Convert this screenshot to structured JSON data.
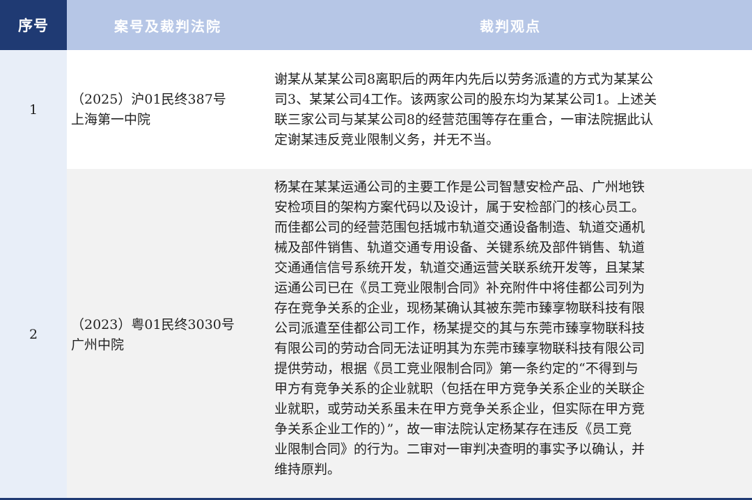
{
  "table": {
    "headers": {
      "index": "序号",
      "case": "案号及裁判法院",
      "view": "裁判观点"
    },
    "rows": [
      {
        "index": "1",
        "case_lines": [
          "（2025）沪01民终387号",
          "上海第一中院"
        ],
        "view_lines": [
          "谢某从某某公司8离职后的两年内先后以劳务派遣的方式为某某公",
          "司3、某某公司4工作。该两家公司的股东均为某某公司1。上述关",
          "联三家公司与某某公司8的经营范围等存在重合，一审法院据此认",
          "定谢某违反竞业限制义务，并无不当。"
        ]
      },
      {
        "index": "2",
        "case_lines": [
          "（2023）粤01民终3030号",
          "广州中院"
        ],
        "view_lines": [
          "杨某在某某运通公司的主要工作是公司智慧安检产品、广州地铁",
          "安检项目的架构方案代码以及设计，属于安检部门的核心员工。",
          "而佳都公司的经营范围包括城市轨道交通设备制造、轨道交通机",
          "械及部件销售、轨道交通专用设备、关键系统及部件销售、轨道",
          "交通通信信号系统开发，轨道交通运营关联系统开发等，且某某",
          "运通公司已在《员工竞业限制合同》补充附件中将佳都公司列为",
          "存在竞争关系的企业，现杨某确认其被东莞市臻享物联科技有限",
          "公司派遣至佳都公司工作，杨某提交的其与东莞市臻享物联科技",
          "有限公司的劳动合同无法证明其为东莞市臻享物联科技有限公司",
          "提供劳动，根据《员工竞业限制合同》第一条约定的“不得到与",
          "甲方有竞争关系的企业就职（包括在甲方竞争关系企业的关联企",
          "业就职，或劳动关系虽未在甲方竞争关系企业，但实际在甲方竞",
          "争关系企业工作的）”，故一审法院认定杨某存在违反《员工竞",
          "业限制合同》的行为。二审对一审判决查明的事实予以确认，并",
          "维持原判。"
        ]
      }
    ]
  }
}
